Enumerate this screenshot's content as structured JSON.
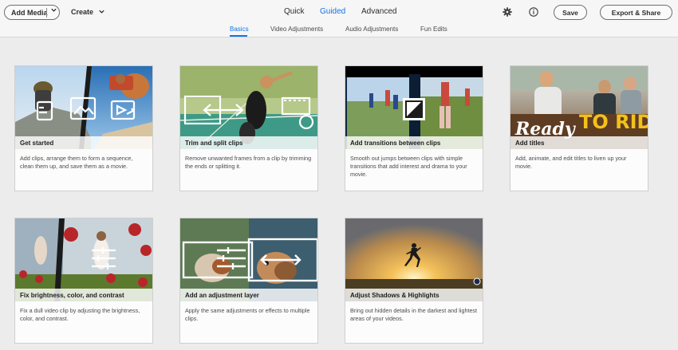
{
  "toolbar": {
    "add_media": "Add Media",
    "create": "Create",
    "modes": [
      "Quick",
      "Guided",
      "Advanced"
    ],
    "active_mode": "Guided",
    "save": "Save",
    "export": "Export & Share"
  },
  "subtabs": [
    "Basics",
    "Video Adjustments",
    "Audio Adjustments",
    "Fun Edits"
  ],
  "active_subtab": "Basics",
  "cards": [
    {
      "title": "Get started",
      "desc": "Add clips, arrange them to form a sequence, clean them up, and save them as a movie."
    },
    {
      "title": "Trim and split clips",
      "desc": "Remove unwanted frames from a clip by trimming the ends or splitting it."
    },
    {
      "title": "Add transitions between clips",
      "desc": "Smooth out jumps between clips with simple transitions that add interest and drama to your movie."
    },
    {
      "title": "Add titles",
      "desc": "Add, animate, and edit titles to liven up your movie.",
      "overlay_text": "Ready TO RIDE!"
    },
    {
      "title": "Fix brightness, color, and contrast",
      "desc": "Fix a dull video clip by adjusting the brightness, color, and contrast."
    },
    {
      "title": "Add an adjustment layer",
      "desc": "Apply the same adjustments or effects to multiple clips."
    },
    {
      "title": "Adjust Shadows & Highlights",
      "desc": "Bring out hidden details in the darkest and lightest areas of your videos."
    }
  ],
  "colors": {
    "accent": "#1473e6"
  }
}
